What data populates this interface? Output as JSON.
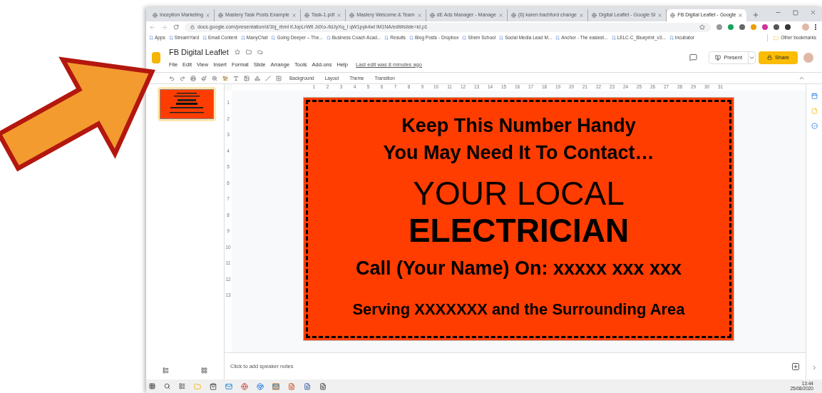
{
  "browser": {
    "tabs": [
      {
        "title": "Inception Marketing",
        "selected": false
      },
      {
        "title": "Mastery Task Posts Example",
        "selected": false
      },
      {
        "title": "Task-1.pdf",
        "selected": false
      },
      {
        "title": "Mastery Welcome & Team",
        "selected": false
      },
      {
        "title": "dE Ads Manager - Manage",
        "selected": false
      },
      {
        "title": "(6) karen bachford change",
        "selected": false
      },
      {
        "title": "Digital Leaflet - Google Sl",
        "selected": false
      },
      {
        "title": "FB Digital Leaflet - Google",
        "selected": true
      }
    ],
    "url": "docs.google.com/presentation/d/1bj_rbml KJopLrWtl JdXo-/tdJyXq_l qW1pyk4wl lM1NA/edit#slide=id.p1",
    "bookmarks": [
      "Apps",
      "StreamYard",
      "Email Content",
      "ManyChat",
      "Going Deeper – The...",
      "Business Coach Acad...",
      "Results",
      "Blog Posts - Dropbox",
      "Shem School",
      "Social Media Lead M...",
      "Anchor - The easiest...",
      "LELC-C_Blueprint_v3...",
      "Incubator"
    ],
    "other_bookmarks": "Other bookmarks"
  },
  "slides": {
    "title": "FB Digital Leaflet",
    "menu": [
      "File",
      "Edit",
      "View",
      "Insert",
      "Format",
      "Slide",
      "Arrange",
      "Tools",
      "Add-ons",
      "Help"
    ],
    "last_edit": "Last edit was 8 minutes ago",
    "present": "Present",
    "share": "Share",
    "toolbar": [
      "Background",
      "Layout",
      "Theme",
      "Transition"
    ],
    "ruler_h": [
      "1",
      "2",
      "3",
      "4",
      "5",
      "6",
      "7",
      "8",
      "9",
      "10",
      "11",
      "12",
      "13",
      "14",
      "15",
      "16",
      "17",
      "18",
      "19",
      "20",
      "21",
      "22",
      "23",
      "24",
      "25",
      "26",
      "27",
      "28",
      "29",
      "30",
      "31"
    ],
    "ruler_v": [
      "1",
      "2",
      "3",
      "4",
      "5",
      "6",
      "7",
      "8",
      "9",
      "10",
      "11",
      "12",
      "13"
    ],
    "thumbnail": {
      "selected": true
    },
    "slide": {
      "lines": [
        {
          "kind": "heading",
          "text": "Keep This Number Handy"
        },
        {
          "kind": "heading",
          "text": "You May Need It To Contact…"
        },
        {
          "kind": "big",
          "text": "YOUR LOCAL"
        },
        {
          "kind": "bigbold",
          "text": "ELECTRICIAN"
        },
        {
          "kind": "heading",
          "text": "Call (Your Name) On: xxxxx xxx xxx"
        },
        {
          "kind": "small",
          "text": "Serving XXXXXXX and the Surrounding Area"
        }
      ]
    },
    "notes_placeholder": "Click to add speaker notes"
  },
  "taskbar": {
    "time": "13:44",
    "date": "25/08/2020"
  }
}
